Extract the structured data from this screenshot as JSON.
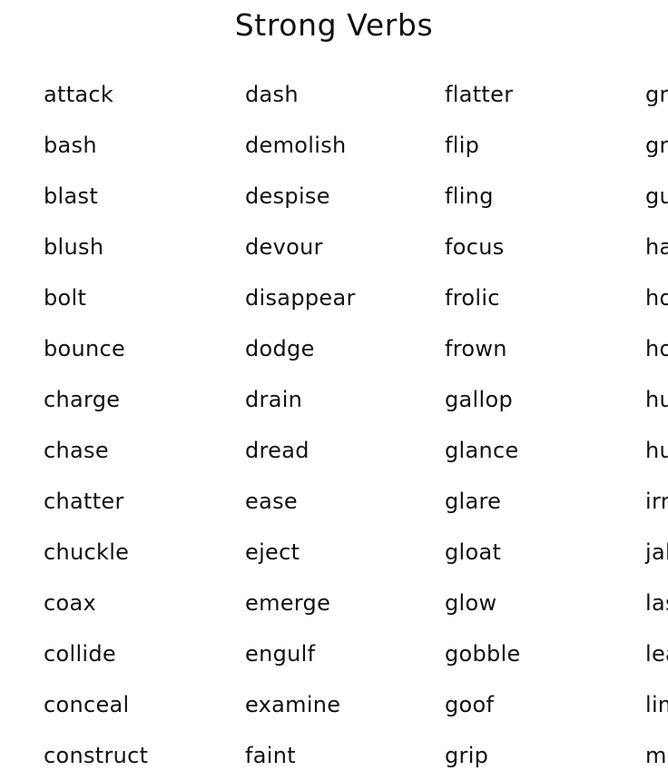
{
  "page": {
    "title": "Strong Verbs",
    "background_color": "#ffffff",
    "text_color": "#111111",
    "column_count": 4,
    "rows_per_column": 14
  },
  "columns": [
    {
      "index": 1,
      "words": [
        "attack",
        "bash",
        "blast",
        "blush",
        "bolt",
        "bounce",
        "charge",
        "chase",
        "chatter",
        "chuckle",
        "coax",
        "collide",
        "conceal",
        "construct"
      ]
    },
    {
      "index": 2,
      "words": [
        "dash",
        "demolish",
        "despise",
        "devour",
        "disappear",
        "dodge",
        "drain",
        "dread",
        "ease",
        "eject",
        "emerge",
        "engulf",
        "examine",
        "faint"
      ]
    },
    {
      "index": 3,
      "words": [
        "flatter",
        "flip",
        "fling",
        "focus",
        "frolic",
        "frown",
        "gallop",
        "glance",
        "glare",
        "gloat",
        "glow",
        "gobble",
        "goof",
        "grip"
      ]
    },
    {
      "index": 4,
      "words": [
        "groan",
        "growl",
        "gulp",
        "haul",
        "honk",
        "howl",
        "humiliate",
        "hunt",
        "irritate",
        "jab",
        "lash",
        "leap",
        "limp",
        "melt"
      ]
    }
  ]
}
